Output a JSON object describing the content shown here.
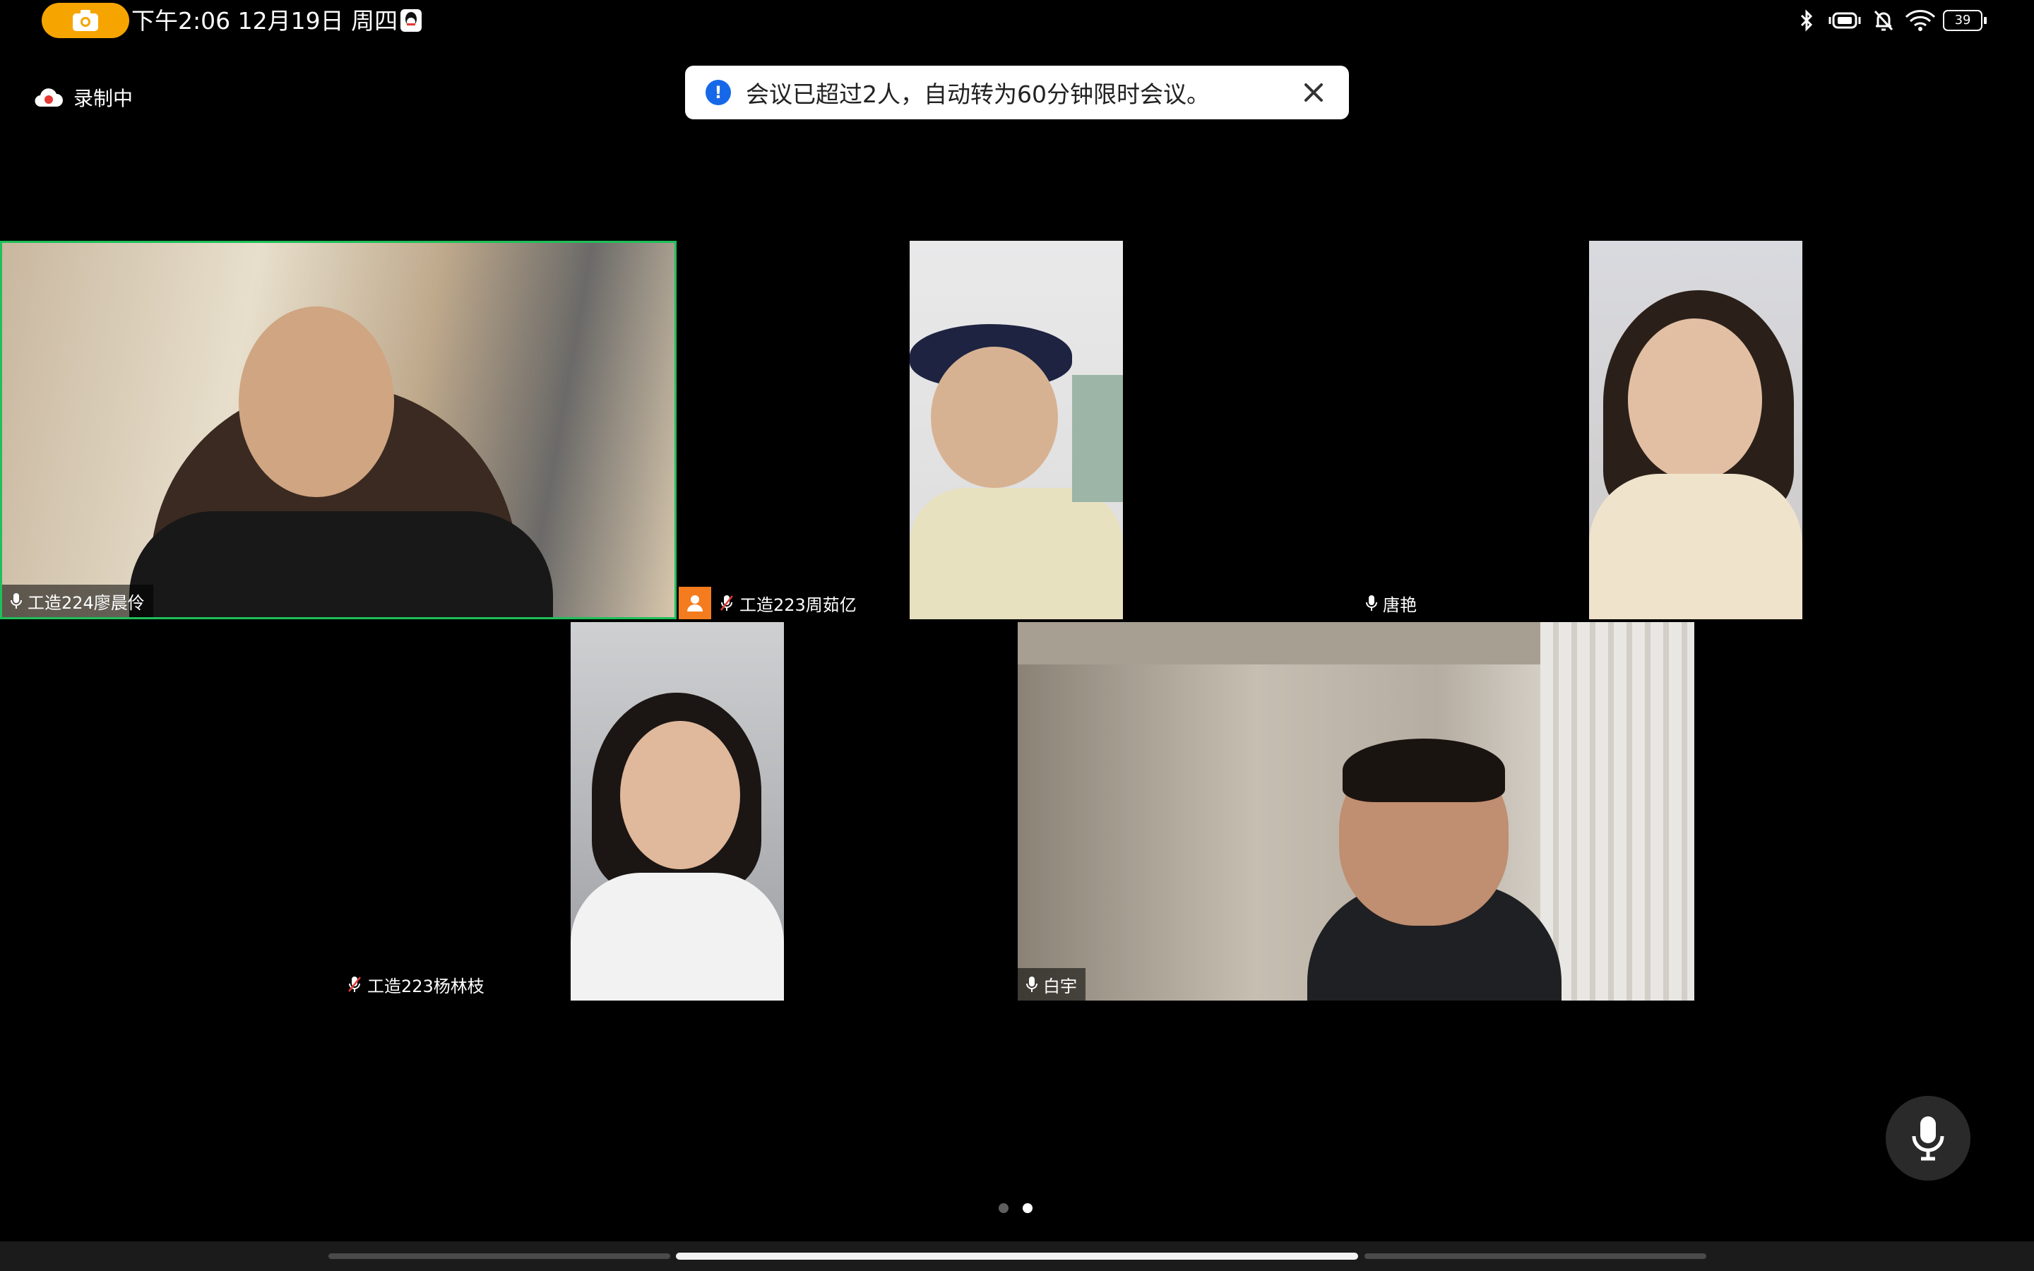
{
  "status_bar": {
    "time_date": "下午2:06 12月19日 周四",
    "battery": "39",
    "icons": [
      "camera-icon",
      "qq-icon",
      "bluetooth-icon",
      "vibrate-icon",
      "mute-bell-icon",
      "wifi-icon",
      "battery-icon"
    ]
  },
  "recording": {
    "label": "录制中",
    "icon": "cloud-record-icon"
  },
  "toast": {
    "message": "会议已超过2人，自动转为60分钟限时会议。",
    "icon": "info-icon",
    "close_icon": "close-icon"
  },
  "participants": [
    {
      "name": "工造224廖晨伶",
      "mic": "mic-icon",
      "active_speaker": true
    },
    {
      "name": "工造223周茹亿",
      "mic": "mic-muted-icon",
      "host_badge": "person-icon"
    },
    {
      "name": "唐艳",
      "mic": "mic-icon"
    },
    {
      "name": "工造223杨林枝",
      "mic": "mic-muted-icon"
    },
    {
      "name": "白宇",
      "mic": "mic-icon"
    }
  ],
  "pagination": {
    "total": 2,
    "current": 2
  },
  "fab": {
    "icon": "microphone-icon"
  },
  "colors": {
    "accent_green": "#1fbf5a",
    "record_pill": "#f6a400",
    "toast_info": "#1768e8",
    "host_badge": "#f47c1e"
  }
}
